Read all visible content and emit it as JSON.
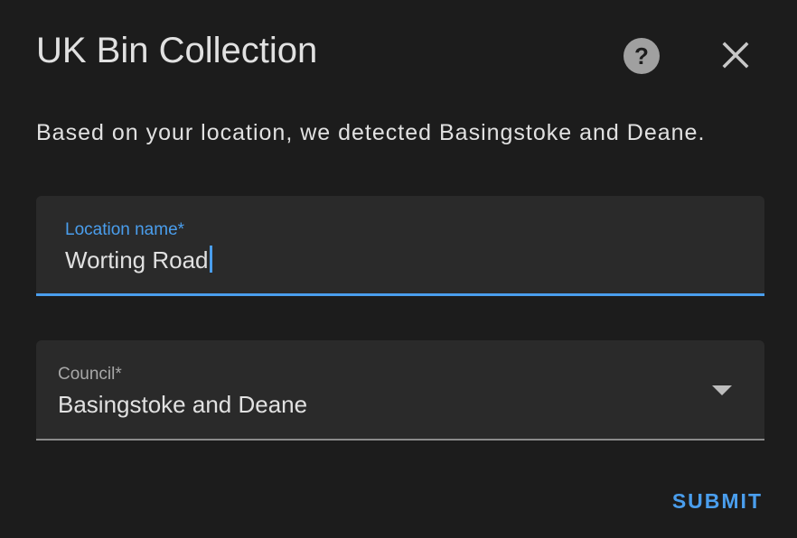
{
  "dialog": {
    "title": "UK Bin Collection",
    "description": "Based on your location, we detected Basingstoke and Deane.",
    "help_icon": "help-circle-icon",
    "close_icon": "close-icon"
  },
  "form": {
    "location": {
      "label": "Location name*",
      "value": "Worting Road",
      "focused": true
    },
    "council": {
      "label": "Council*",
      "value": "Basingstoke and Deane",
      "icon": "chevron-down-icon"
    }
  },
  "actions": {
    "submit_label": "SUBMIT"
  },
  "colors": {
    "background": "#1c1c1c",
    "field_background": "#2a2a2a",
    "accent": "#4a9eed",
    "text": "#e1e1e1",
    "muted": "#a8a8a8"
  }
}
